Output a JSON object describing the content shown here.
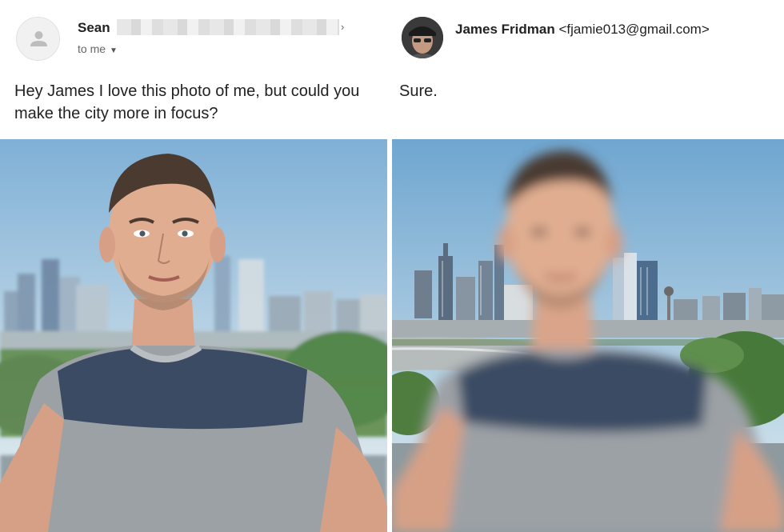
{
  "left_email": {
    "sender_name": "Sean",
    "recipient_label": "to me",
    "message": "Hey James I love this photo of me, but could you make the city more in focus?"
  },
  "right_email": {
    "sender_name": "James Fridman",
    "sender_email": "<fjamie013@gmail.com>",
    "message": "Sure."
  },
  "icons": {
    "left_avatar": "person-silhouette-icon",
    "recipient_dropdown": "caret-down-icon",
    "redaction": "pixelated-redaction",
    "redaction_expand": "chevron-right-icon"
  },
  "colors": {
    "sky_top": "#7fb0d6",
    "sky_bottom": "#dfe9ec",
    "shirt_dark": "#3d4d66",
    "shirt_light": "#9aa0a6",
    "foliage": "#4f8a3e"
  }
}
